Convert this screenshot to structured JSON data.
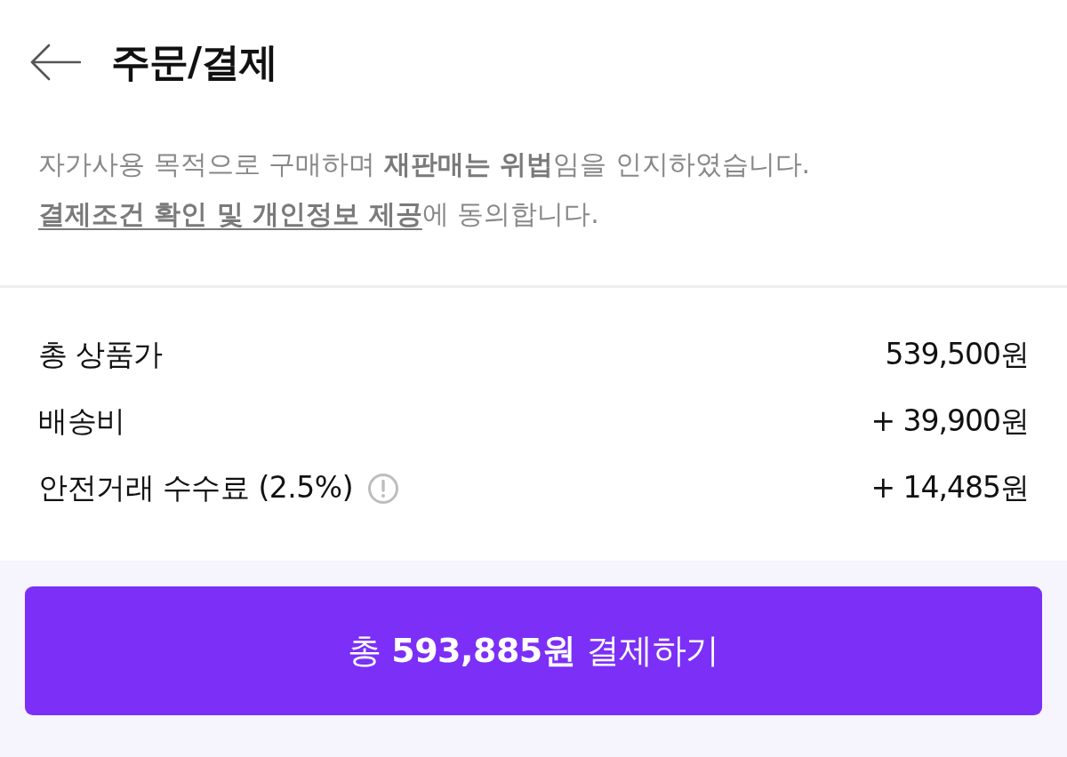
{
  "header": {
    "title": "주문/결제"
  },
  "notice": {
    "line_1": "자가사용 목적으로 구매하며 **재판매는 위법**임을 인지하였습니다.",
    "line_2": {
      "link": "결제조건 확인 및 개인정보 제공",
      "text": "에 동의합니다."
    }
  },
  "summary": [
    {
      "label": "총 상품가",
      "amount": "539,500원",
      "info_icon": false
    },
    {
      "label": "배송비",
      "amount": "+ 39,900원",
      "info_icon": false
    },
    {
      "label": "안전거래 수수료 (2.5%)",
      "amount": "+ 14,485원",
      "info_icon": true
    }
  ],
  "pay_button": {
    "label": "총 **593,885원** 결제하기"
  }
}
